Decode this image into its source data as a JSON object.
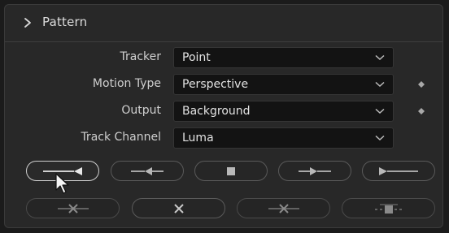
{
  "panel": {
    "title": "Pattern",
    "rows": [
      {
        "label": "Tracker",
        "value": "Point",
        "has_keyframe": false
      },
      {
        "label": "Motion Type",
        "value": "Perspective",
        "has_keyframe": true
      },
      {
        "label": "Output",
        "value": "Background",
        "has_keyframe": true
      },
      {
        "label": "Track Channel",
        "value": "Luma",
        "has_keyframe": false
      }
    ]
  },
  "track_buttons": [
    {
      "name": "track-reverse-button",
      "icon": "track-reverse-icon",
      "active": true
    },
    {
      "name": "track-previous-frame-button",
      "icon": "track-previous-frame-icon",
      "active": false
    },
    {
      "name": "stop-tracking-button",
      "icon": "stop-icon",
      "active": false
    },
    {
      "name": "track-next-frame-button",
      "icon": "track-next-frame-icon",
      "active": false
    },
    {
      "name": "track-forward-button",
      "icon": "track-forward-icon",
      "active": false
    }
  ],
  "clear_buttons": [
    {
      "name": "clear-all-previous-button",
      "icon": "clear-previous-icon"
    },
    {
      "name": "clear-all-button",
      "icon": "clear-all-icon"
    },
    {
      "name": "clear-all-next-button",
      "icon": "clear-next-icon"
    },
    {
      "name": "set-pattern-keyframe-button",
      "icon": "pattern-keyframe-icon"
    }
  ],
  "colors": {
    "panel_bg": "#282828",
    "field_bg": "#131313",
    "text": "#cfcfcf",
    "active_outline": "#cfcfcf"
  }
}
